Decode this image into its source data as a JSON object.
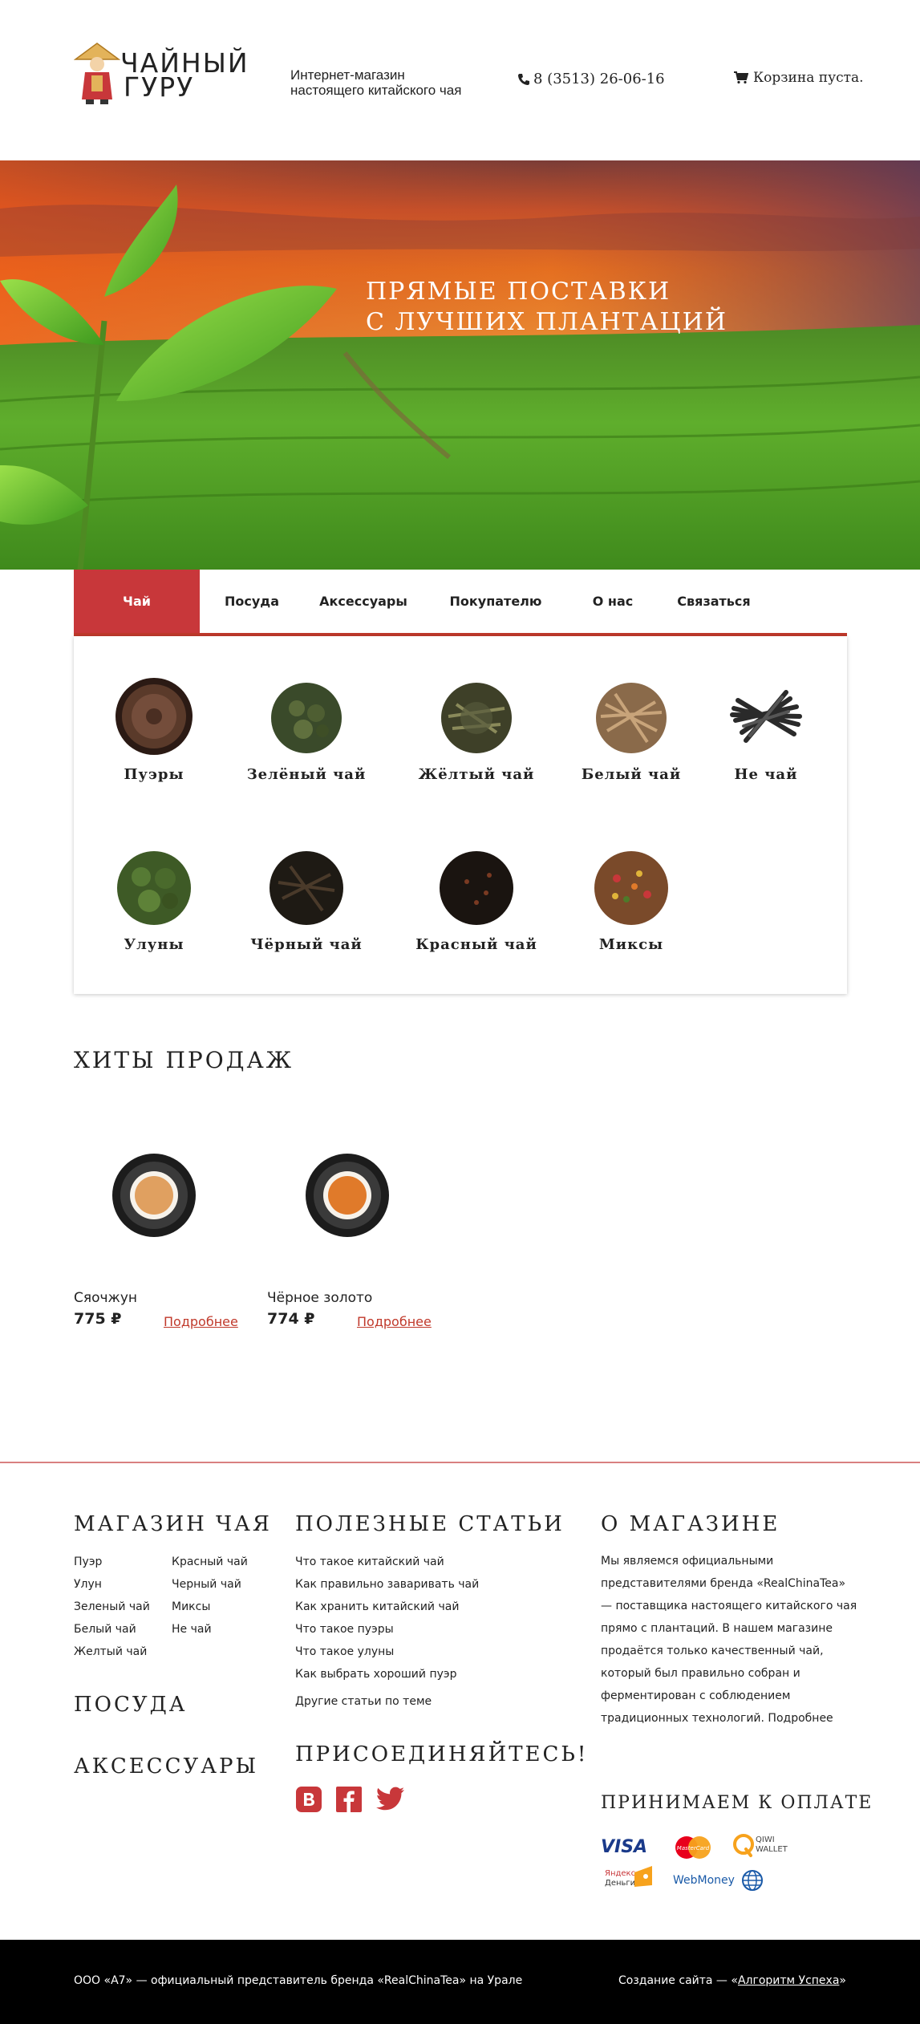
{
  "header": {
    "logo_text": "ЧАЙНЫЙ ГУРУ",
    "logo_line1": "ЧАЙНЫЙ",
    "logo_line2": "ГУРУ",
    "tagline_line1": "Интернет-магазин",
    "tagline_line2": "настоящего китайского чая",
    "phone": "8 (3513) 26-06-16",
    "phone_icon": "phone-icon",
    "cart_text": "Корзина пуста.",
    "cart_icon": "cart-icon"
  },
  "hero": {
    "line1": "ПРЯМЫЕ ПОСТАВКИ",
    "line2": "С ЛУЧШИХ ПЛАНТАЦИЙ"
  },
  "nav": {
    "items": [
      {
        "label": "Чай",
        "active": true
      },
      {
        "label": "Посуда"
      },
      {
        "label": "Аксессуары"
      },
      {
        "label": "Покупателю"
      },
      {
        "label": "О нас"
      },
      {
        "label": "Связаться"
      }
    ]
  },
  "catalog": {
    "items": [
      {
        "label": "Пуэры"
      },
      {
        "label": "Зелёный чай"
      },
      {
        "label": "Жёлтый чай"
      },
      {
        "label": "Белый чай"
      },
      {
        "label": "Не чай"
      },
      {
        "label": "Улуны"
      },
      {
        "label": "Чёрный чай"
      },
      {
        "label": "Красный чай"
      },
      {
        "label": "Миксы"
      }
    ]
  },
  "hits": {
    "title": "ХИТЫ ПРОДАЖ",
    "products": [
      {
        "name": "Сяочжун",
        "price": "775 ₽",
        "more": "Подробнее"
      },
      {
        "name": "Чёрное золото",
        "price": "774 ₽",
        "more": "Подробнее"
      }
    ]
  },
  "footer": {
    "shop_title": "МАГАЗИН ЧАЯ",
    "shop_col1": [
      "Пуэр",
      "Улун",
      "Зеленый чай",
      "Белый чай",
      "Желтый чай"
    ],
    "shop_col2": [
      "Красный чай",
      "Черный чай",
      "Миксы",
      "Не чай"
    ],
    "dishes_title": "ПОСУДА",
    "accessories_title": "АКСЕССУАРЫ",
    "articles_title": "ПОЛЕЗНЫЕ СТАТЬИ",
    "articles": [
      "Что такое китайский чай",
      "Как правильно заваривать чай",
      "Как хранить китайский чай",
      "Что такое пуэры",
      "Что такое улуны",
      "Как выбрать хороший пуэр"
    ],
    "other_articles": "Другие статьи по теме",
    "join_title": "ПРИСОЕДИНЯЙТЕСЬ!",
    "about_title": "О МАГАЗИНЕ",
    "about_text": "Мы являемся официальными представителями бренда «RealChinaTea» — поставщика настоящего китайского чая прямо с плантаций. В нашем магазине продаётся только качественный чай, который был правильно собран и ферментирован с соблюдением традиционных технологий. Подробнее",
    "payment_title": "ПРИНИМАЕМ К ОПЛАТЕ",
    "payments": {
      "visa": "VISA",
      "mastercard": "MasterCard",
      "qiwi_1": "QIWI",
      "qiwi_2": "WALLET",
      "yandex_1": "Яндекс",
      "yandex_2": "Деньги",
      "webmoney": "WebMoney"
    },
    "copyright": "ООО «А7» — официальный представитель бренда «RealChinaTea» на Урале",
    "credit_prefix": "Создание сайта — «",
    "credit_link": "Алгоритм Успеха",
    "credit_suffix": "»"
  },
  "colors": {
    "accent": "#c8373a",
    "text": "#222222",
    "footer_bg": "#000000"
  }
}
